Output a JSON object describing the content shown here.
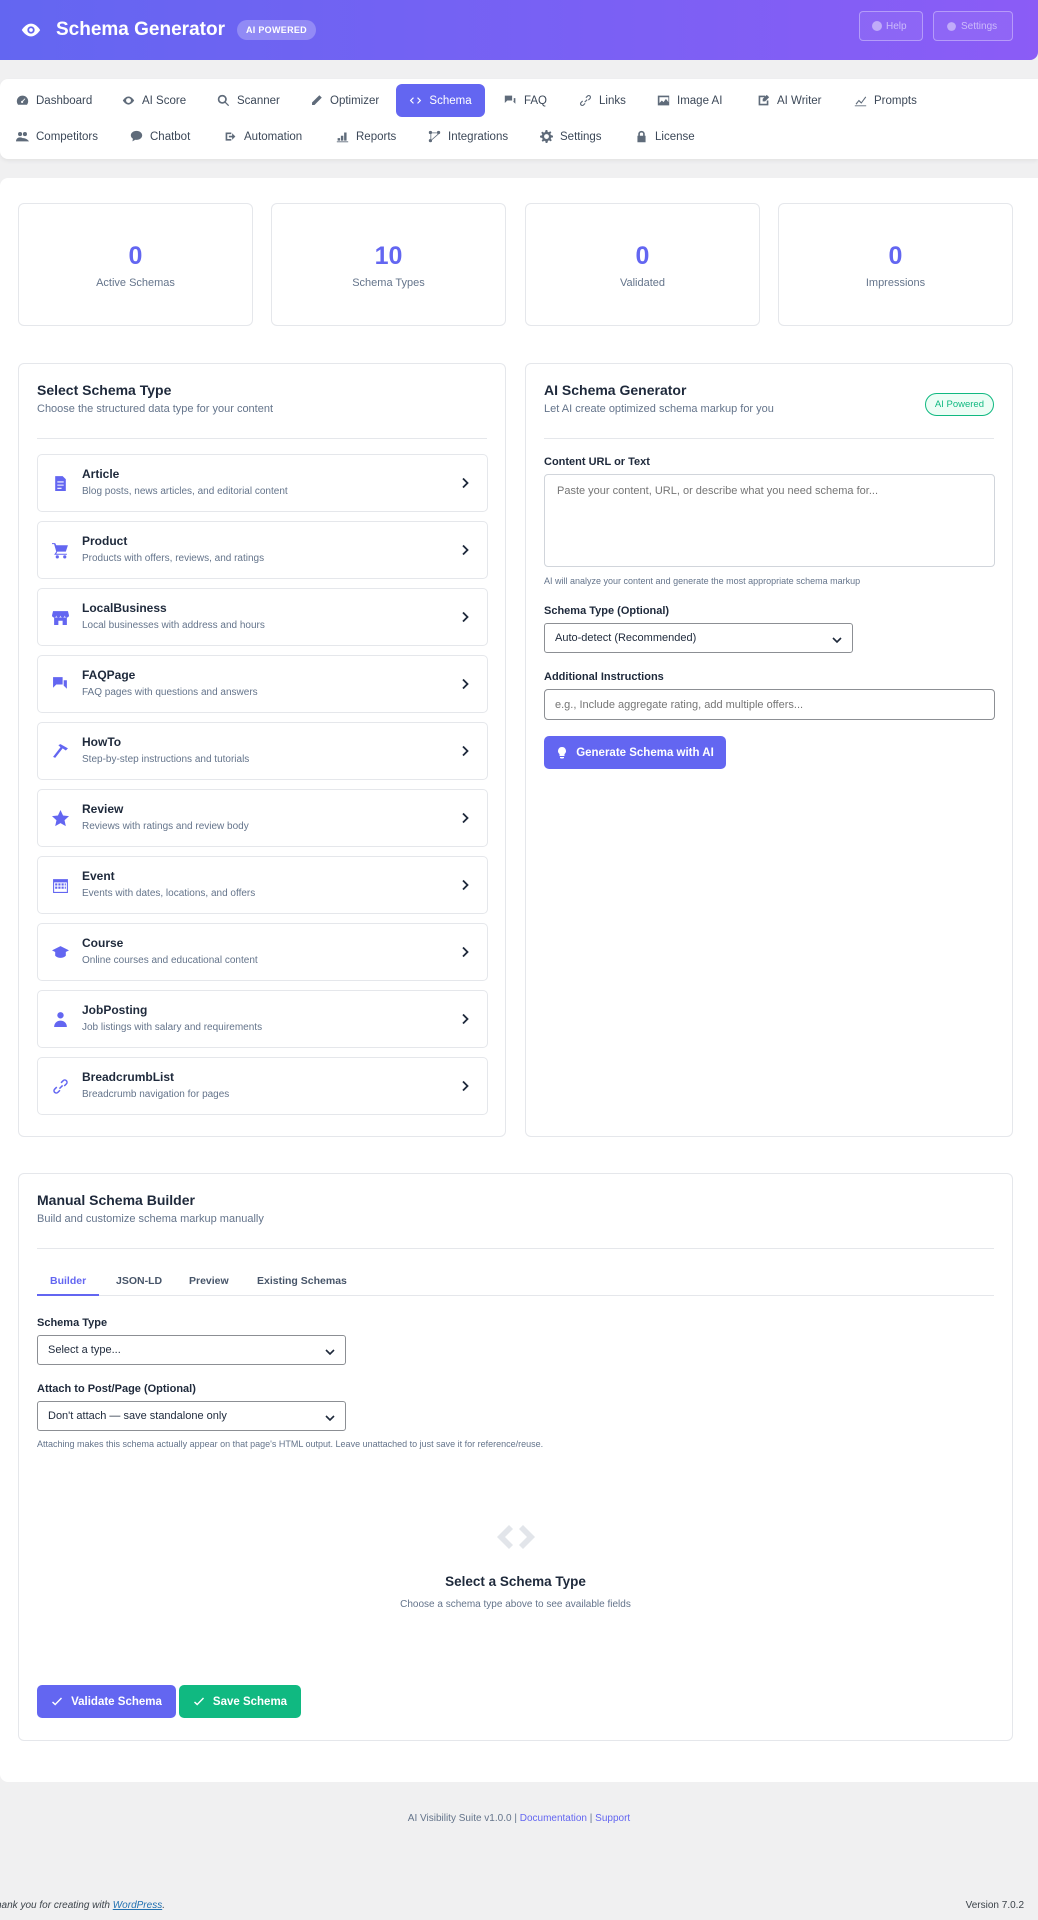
{
  "header": {
    "title": "Schema Generator",
    "badge": "AI POWERED",
    "help_label": "Help",
    "settings_label": "Settings"
  },
  "nav": {
    "row1": [
      {
        "label": "Dashboard",
        "icon": "dashboard-icon"
      },
      {
        "label": "AI Score",
        "icon": "eye-icon"
      },
      {
        "label": "Scanner",
        "icon": "search-icon"
      },
      {
        "label": "Optimizer",
        "icon": "pencil-icon"
      },
      {
        "label": "Schema",
        "icon": "code-icon",
        "active": true
      },
      {
        "label": "FAQ",
        "icon": "chat-icon"
      },
      {
        "label": "Links",
        "icon": "link-icon"
      },
      {
        "label": "Image AI",
        "icon": "image-icon"
      },
      {
        "label": "AI Writer",
        "icon": "write-icon"
      },
      {
        "label": "Prompts",
        "icon": "chart-line-icon"
      }
    ],
    "row2": [
      {
        "label": "Competitors",
        "icon": "group-icon"
      },
      {
        "label": "Chatbot",
        "icon": "chat-bubble-icon"
      },
      {
        "label": "Automation",
        "icon": "redo-icon"
      },
      {
        "label": "Reports",
        "icon": "bar-chart-icon"
      },
      {
        "label": "Integrations",
        "icon": "integration-icon"
      },
      {
        "label": "Settings",
        "icon": "gear-icon"
      },
      {
        "label": "License",
        "icon": "lock-icon"
      }
    ]
  },
  "stats": [
    {
      "value": "0",
      "label": "Active Schemas"
    },
    {
      "value": "10",
      "label": "Schema Types"
    },
    {
      "value": "0",
      "label": "Validated"
    },
    {
      "value": "0",
      "label": "Impressions"
    }
  ],
  "select_schema": {
    "title": "Select Schema Type",
    "subtitle": "Choose the structured data type for your content",
    "items": [
      {
        "name": "Article",
        "desc": "Blog posts, news articles, and editorial content",
        "icon": "document-icon"
      },
      {
        "name": "Product",
        "desc": "Products with offers, reviews, and ratings",
        "icon": "cart-icon"
      },
      {
        "name": "LocalBusiness",
        "desc": "Local businesses with address and hours",
        "icon": "store-icon"
      },
      {
        "name": "FAQPage",
        "desc": "FAQ pages with questions and answers",
        "icon": "chat-icon"
      },
      {
        "name": "HowTo",
        "desc": "Step-by-step instructions and tutorials",
        "icon": "hammer-icon"
      },
      {
        "name": "Review",
        "desc": "Reviews with ratings and review body",
        "icon": "star-icon"
      },
      {
        "name": "Event",
        "desc": "Events with dates, locations, and offers",
        "icon": "calendar-icon"
      },
      {
        "name": "Course",
        "desc": "Online courses and educational content",
        "icon": "graduation-cap-icon"
      },
      {
        "name": "JobPosting",
        "desc": "Job listings with salary and requirements",
        "icon": "user-icon"
      },
      {
        "name": "BreadcrumbList",
        "desc": "Breadcrumb navigation for pages",
        "icon": "link-icon"
      }
    ]
  },
  "ai_generator": {
    "title": "AI Schema Generator",
    "subtitle": "Let AI create optimized schema markup for you",
    "badge": "AI Powered",
    "content_label": "Content URL or Text",
    "content_placeholder": "Paste your content, URL, or describe what you need schema for...",
    "content_hint": "AI will analyze your content and generate the most appropriate schema markup",
    "type_label": "Schema Type (Optional)",
    "type_value": "Auto-detect (Recommended)",
    "instructions_label": "Additional Instructions",
    "instructions_placeholder": "e.g., Include aggregate rating, add multiple offers...",
    "generate_button": "Generate Schema with AI"
  },
  "manual": {
    "title": "Manual Schema Builder",
    "subtitle": "Build and customize schema markup manually",
    "tabs": [
      "Builder",
      "JSON-LD",
      "Preview",
      "Existing Schemas"
    ],
    "schema_type_label": "Schema Type",
    "schema_type_value": "Select a type...",
    "attach_label": "Attach to Post/Page (Optional)",
    "attach_value": "Don't attach — save standalone only",
    "attach_hint": "Attaching makes this schema actually appear on that page's HTML output. Leave unattached to just save it for reference/reuse.",
    "empty_title": "Select a Schema Type",
    "empty_sub": "Choose a schema type above to see available fields",
    "validate_button": "Validate Schema",
    "save_button": "Save Schema"
  },
  "footer": {
    "suite": "AI Visibility Suite v1.0.0 |",
    "docs": "Documentation",
    "sep": "|",
    "support": "Support",
    "wp_text": "hank you for creating with",
    "wp_link": "WordPress",
    "wp_dot": ".",
    "version": "Version 7.0.2"
  },
  "colors": {
    "accent": "#6366f1",
    "success": "#10b981",
    "header_gradient_end": "#8b5cf6"
  }
}
